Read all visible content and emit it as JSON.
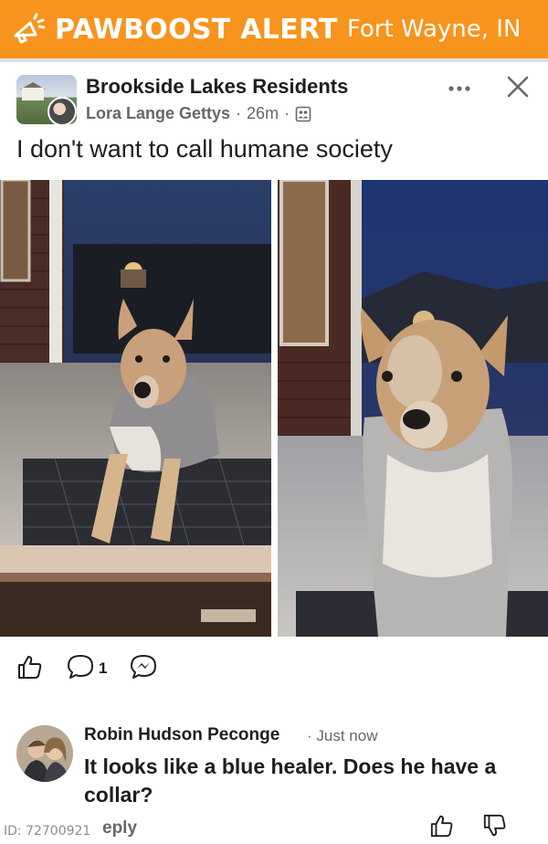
{
  "header": {
    "brand": "PAWBOOST ALERT",
    "location": "Fort Wayne, IN",
    "brand_color": "#f7941d"
  },
  "post": {
    "group_name": "Brookside Lakes Residents",
    "author": "Lora Lange Gettys",
    "time": "26m",
    "separator": "·",
    "text": "I don't want to call humane society",
    "comment_count": "1",
    "icons": {
      "more": "more-horizontal-icon",
      "close": "close-icon",
      "audience": "group-audience-icon",
      "like": "thumbs-up-icon",
      "comment": "comment-icon",
      "share": "messenger-icon"
    }
  },
  "comment": {
    "name": "Robin Hudson Peconge",
    "time": "Just now",
    "text": "It looks like a blue healer. Does he have a collar?",
    "reply_label": "eply",
    "icons": {
      "like": "thumbs-up-icon",
      "dislike": "thumbs-down-icon"
    }
  },
  "footer": {
    "id_label": "ID: 72700921"
  }
}
